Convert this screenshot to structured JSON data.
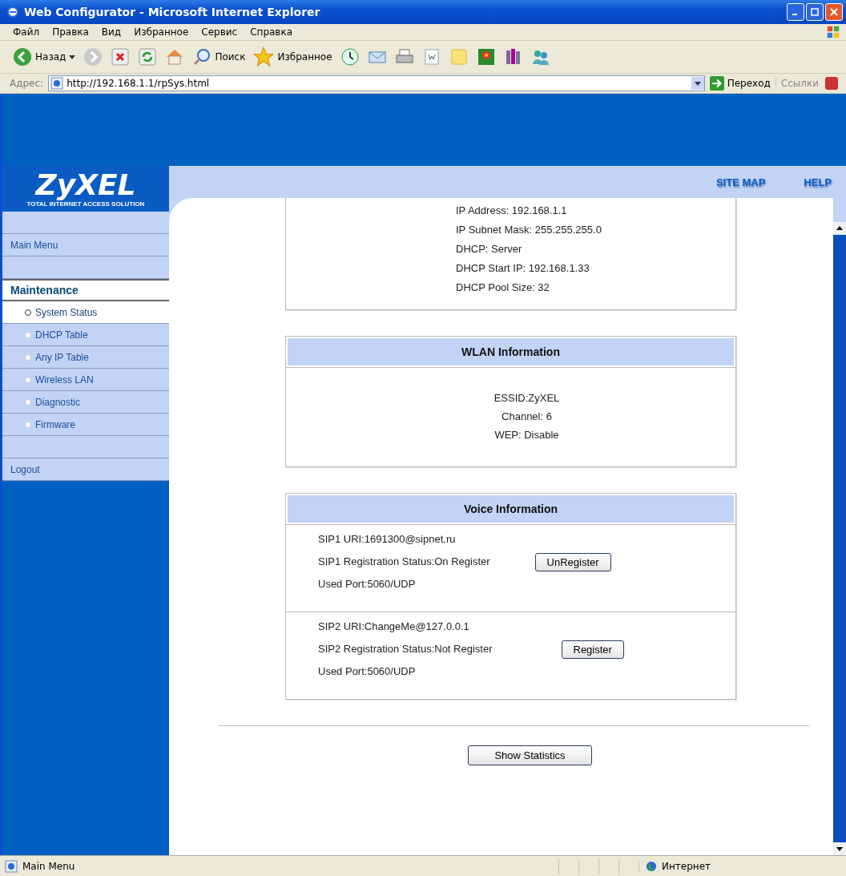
{
  "window": {
    "title": "Web Configurator - Microsoft Internet Explorer"
  },
  "menu_bar": [
    "Файл",
    "Правка",
    "Вид",
    "Избранное",
    "Сервис",
    "Справка"
  ],
  "toolbar": {
    "back": "Назад",
    "search": "Поиск",
    "favorites": "Избранное"
  },
  "address_bar": {
    "label": "Адрес:",
    "value": "http://192.168.1.1/rpSys.html",
    "go": "Переход",
    "links": "Ссылки"
  },
  "logo": {
    "title": "ZyXEL",
    "tagline": "TOTAL INTERNET ACCESS SOLUTION"
  },
  "header_links": [
    "SITE MAP",
    "HELP"
  ],
  "sidebar": [
    {
      "kind": "spacer"
    },
    {
      "kind": "link",
      "label": "Main Menu"
    },
    {
      "kind": "spacer"
    },
    {
      "kind": "section",
      "label": "Maintenance"
    },
    {
      "kind": "item",
      "label": "System Status",
      "selected": true
    },
    {
      "kind": "item",
      "label": "DHCP Table",
      "selected": false
    },
    {
      "kind": "item",
      "label": "Any IP Table",
      "selected": false
    },
    {
      "kind": "item",
      "label": "Wireless LAN",
      "selected": false
    },
    {
      "kind": "item",
      "label": "Diagnostic",
      "selected": false
    },
    {
      "kind": "item",
      "label": "Firmware",
      "selected": false
    },
    {
      "kind": "spacer"
    },
    {
      "kind": "link",
      "label": "Logout"
    }
  ],
  "lan_lines": [
    "IP Address: 192.168.1.1",
    "IP Subnet Mask: 255.255.255.0",
    "DHCP: Server",
    "DHCP Start IP: 192.168.1.33",
    "DHCP Pool Size: 32"
  ],
  "wlan": {
    "title": "WLAN Information",
    "lines": [
      "ESSID:ZyXEL",
      "Channel: 6",
      "WEP: Disable"
    ]
  },
  "voice": {
    "title": "Voice Information",
    "accounts": [
      {
        "uri": "SIP1 URI:1691300@sipnet.ru",
        "status": "SIP1 Registration Status:On Register",
        "port": "Used Port:5060/UDP",
        "button": "UnRegister"
      },
      {
        "uri": "SIP2 URI:ChangeMe@127.0.0.1",
        "status": "SIP2 Registration Status:Not Register",
        "port": "Used Port:5060/UDP",
        "button": "Register"
      }
    ]
  },
  "show_statistics": "Show Statistics",
  "status_bar": {
    "text": "Main Menu",
    "zone": "Интернет"
  }
}
